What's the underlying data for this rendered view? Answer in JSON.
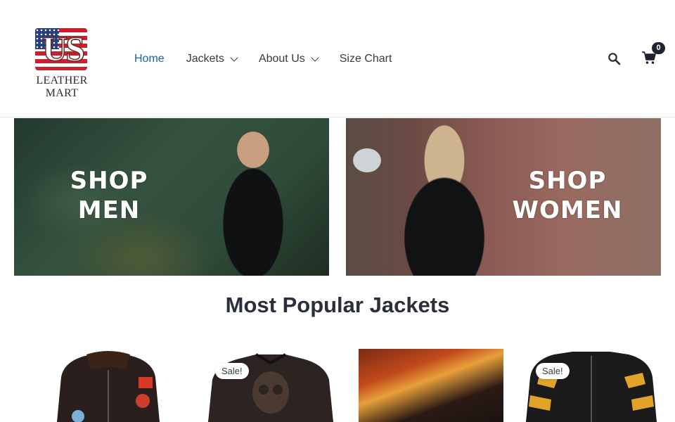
{
  "brand": {
    "logo_text": "LEATHER MART",
    "logo_mark": "US"
  },
  "nav": {
    "items": [
      {
        "label": "Home",
        "active": true,
        "has_dropdown": false
      },
      {
        "label": "Jackets",
        "active": false,
        "has_dropdown": true
      },
      {
        "label": "About Us",
        "active": false,
        "has_dropdown": true
      },
      {
        "label": "Size Chart",
        "active": false,
        "has_dropdown": false
      }
    ],
    "search_icon": "search-icon",
    "cart_icon": "cart-icon",
    "cart_count": "0"
  },
  "banners": [
    {
      "line1": "SHOP",
      "line2": "MEN"
    },
    {
      "line1": "SHOP",
      "line2": "WOMEN"
    }
  ],
  "section": {
    "title": "Most Popular Jackets"
  },
  "products": [
    {
      "badge": ""
    },
    {
      "badge": "Sale!"
    },
    {
      "badge": ""
    },
    {
      "badge": "Sale!"
    }
  ],
  "colors": {
    "accent": "#1e5fa8",
    "text": "#3a3a3a",
    "badge_bg": "#1f2230"
  }
}
